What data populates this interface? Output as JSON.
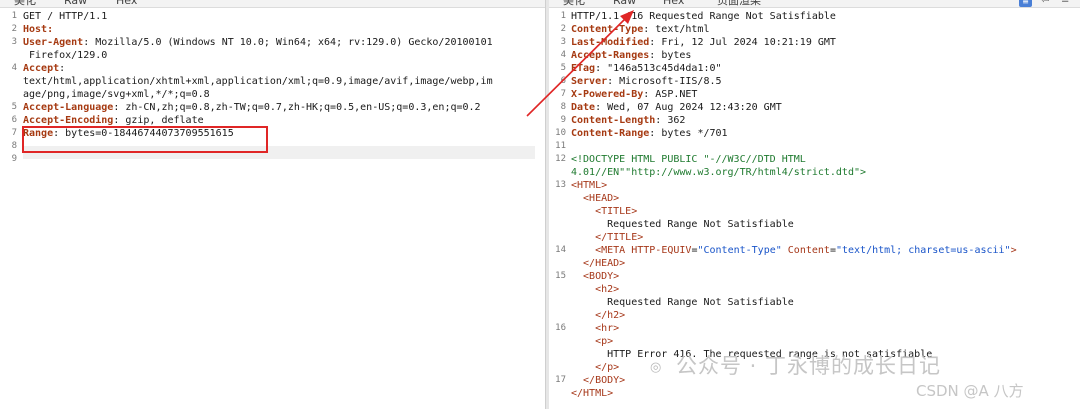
{
  "request": {
    "tabs": [
      "美化",
      "Raw",
      "Hex"
    ],
    "lines": [
      {
        "n": "1",
        "parts": [
          {
            "t": "GET / HTTP/1.1",
            "c": ""
          }
        ]
      },
      {
        "n": "2",
        "parts": [
          {
            "t": "Host: ",
            "c": "k"
          },
          {
            "t": "",
            "c": ""
          }
        ]
      },
      {
        "n": "3",
        "parts": [
          {
            "t": "User-Agent",
            "c": "k"
          },
          {
            "t": ": Mozilla/5.0 (Windows NT 10.0; Win64; x64; rv:129.0) Gecko/20100101",
            "c": ""
          }
        ]
      },
      {
        "n": "",
        "parts": [
          {
            "t": " Firefox/129.0",
            "c": ""
          }
        ]
      },
      {
        "n": "4",
        "parts": [
          {
            "t": "Accept",
            "c": "k"
          },
          {
            "t": ":",
            "c": ""
          }
        ]
      },
      {
        "n": "",
        "parts": [
          {
            "t": "text/html,application/xhtml+xml,application/xml;q=0.9,image/avif,image/webp,im",
            "c": ""
          }
        ]
      },
      {
        "n": "",
        "parts": [
          {
            "t": "age/png,image/svg+xml,*/*;q=0.8",
            "c": ""
          }
        ]
      },
      {
        "n": "5",
        "parts": [
          {
            "t": "Accept-Language",
            "c": "k"
          },
          {
            "t": ": zh-CN,zh;q=0.8,zh-TW;q=0.7,zh-HK;q=0.5,en-US;q=0.3,en;q=0.2",
            "c": ""
          }
        ]
      },
      {
        "n": "6",
        "parts": [
          {
            "t": "Accept-Encoding",
            "c": "k"
          },
          {
            "t": ": gzip, deflate",
            "c": ""
          }
        ]
      },
      {
        "n": "7",
        "parts": [
          {
            "t": "Range",
            "c": "k"
          },
          {
            "t": ": bytes=0-18446744073709551615",
            "c": ""
          }
        ]
      },
      {
        "n": "8",
        "parts": [
          {
            "t": "",
            "c": ""
          }
        ]
      },
      {
        "n": "9",
        "parts": [
          {
            "t": "",
            "c": ""
          }
        ]
      }
    ]
  },
  "response": {
    "tabs": [
      "美化",
      "Raw",
      "Hex",
      "页面渲染"
    ],
    "lines": [
      {
        "n": "1",
        "parts": [
          {
            "t": "HTTP/1.1 416 Requested Range Not Satisfiable",
            "c": ""
          }
        ]
      },
      {
        "n": "2",
        "parts": [
          {
            "t": "Content-Type",
            "c": "k"
          },
          {
            "t": ": text/html",
            "c": ""
          }
        ]
      },
      {
        "n": "3",
        "parts": [
          {
            "t": "Last-Modified",
            "c": "k"
          },
          {
            "t": ": Fri, 12 Jul 2024 10:21:19 GMT",
            "c": ""
          }
        ]
      },
      {
        "n": "4",
        "parts": [
          {
            "t": "Accept-Ranges",
            "c": "k"
          },
          {
            "t": ": bytes",
            "c": ""
          }
        ]
      },
      {
        "n": "5",
        "parts": [
          {
            "t": "ETag",
            "c": "k"
          },
          {
            "t": ": \"146a513c45d4da1:0\"",
            "c": ""
          }
        ]
      },
      {
        "n": "6",
        "parts": [
          {
            "t": "Server",
            "c": "k"
          },
          {
            "t": ": Microsoft-IIS/8.5",
            "c": ""
          }
        ]
      },
      {
        "n": "7",
        "parts": [
          {
            "t": "X-Powered-By",
            "c": "k"
          },
          {
            "t": ": ASP.NET",
            "c": ""
          }
        ]
      },
      {
        "n": "8",
        "parts": [
          {
            "t": "Date",
            "c": "k"
          },
          {
            "t": ": Wed, 07 Aug 2024 12:43:20 GMT",
            "c": ""
          }
        ]
      },
      {
        "n": "9",
        "parts": [
          {
            "t": "Content-Length",
            "c": "k"
          },
          {
            "t": ": 362",
            "c": ""
          }
        ]
      },
      {
        "n": "10",
        "parts": [
          {
            "t": "Content-Range",
            "c": "k"
          },
          {
            "t": ": bytes */701",
            "c": ""
          }
        ]
      },
      {
        "n": "11",
        "parts": [
          {
            "t": "",
            "c": ""
          }
        ]
      },
      {
        "n": "12",
        "parts": [
          {
            "t": "<!DOCTYPE HTML PUBLIC \"-//W3C//DTD HTML",
            "c": "comment"
          }
        ]
      },
      {
        "n": "",
        "parts": [
          {
            "t": "4.01//EN\"\"http://www.w3.org/TR/html4/strict.dtd\">",
            "c": "comment"
          }
        ]
      },
      {
        "n": "13",
        "parts": [
          {
            "t": "<HTML>",
            "c": "tag"
          }
        ]
      },
      {
        "n": "",
        "parts": [
          {
            "t": "  <HEAD>",
            "c": "tag"
          }
        ]
      },
      {
        "n": "",
        "parts": [
          {
            "t": "    <TITLE>",
            "c": "tag"
          }
        ]
      },
      {
        "n": "",
        "parts": [
          {
            "t": "      Requested Range Not Satisfiable",
            "c": ""
          }
        ]
      },
      {
        "n": "",
        "parts": [
          {
            "t": "    </TITLE>",
            "c": "tag"
          }
        ]
      },
      {
        "n": "14",
        "parts": [
          {
            "t": "    <META ",
            "c": "tag"
          },
          {
            "t": "HTTP-EQUIV",
            "c": "attr"
          },
          {
            "t": "=",
            "c": ""
          },
          {
            "t": "\"Content-Type\"",
            "c": "str"
          },
          {
            "t": " Content",
            "c": "attr"
          },
          {
            "t": "=",
            "c": ""
          },
          {
            "t": "\"text/html; charset=us-ascii\"",
            "c": "str"
          },
          {
            "t": ">",
            "c": "tag"
          }
        ]
      },
      {
        "n": "",
        "parts": [
          {
            "t": "  </HEAD>",
            "c": "tag"
          }
        ]
      },
      {
        "n": "15",
        "parts": [
          {
            "t": "  <BODY>",
            "c": "tag"
          }
        ]
      },
      {
        "n": "",
        "parts": [
          {
            "t": "    <h2>",
            "c": "tag"
          }
        ]
      },
      {
        "n": "",
        "parts": [
          {
            "t": "      Requested Range Not Satisfiable",
            "c": ""
          }
        ]
      },
      {
        "n": "",
        "parts": [
          {
            "t": "    </h2>",
            "c": "tag"
          }
        ]
      },
      {
        "n": "16",
        "parts": [
          {
            "t": "    <hr>",
            "c": "tag"
          }
        ]
      },
      {
        "n": "",
        "parts": [
          {
            "t": "    <p>",
            "c": "tag"
          }
        ]
      },
      {
        "n": "",
        "parts": [
          {
            "t": "      HTTP Error 416. The requested range is not satisfiable",
            "c": ""
          }
        ]
      },
      {
        "n": "",
        "parts": [
          {
            "t": "    </p>",
            "c": "tag"
          }
        ]
      },
      {
        "n": "17",
        "parts": [
          {
            "t": "  </BODY>",
            "c": "tag"
          }
        ]
      },
      {
        "n": "",
        "parts": [
          {
            "t": "</HTML>",
            "c": "tag"
          }
        ]
      }
    ]
  },
  "watermark": {
    "wechat": "公众号 · 丁永博的成长日记",
    "csdn": "CSDN @A  八方"
  },
  "colors": {
    "highlight_box": "#e02626",
    "arrow": "#e02626",
    "header_key": "#a63a12",
    "tag": "#a6381a",
    "string": "#1a55c9",
    "comment": "#1f7a2f"
  }
}
